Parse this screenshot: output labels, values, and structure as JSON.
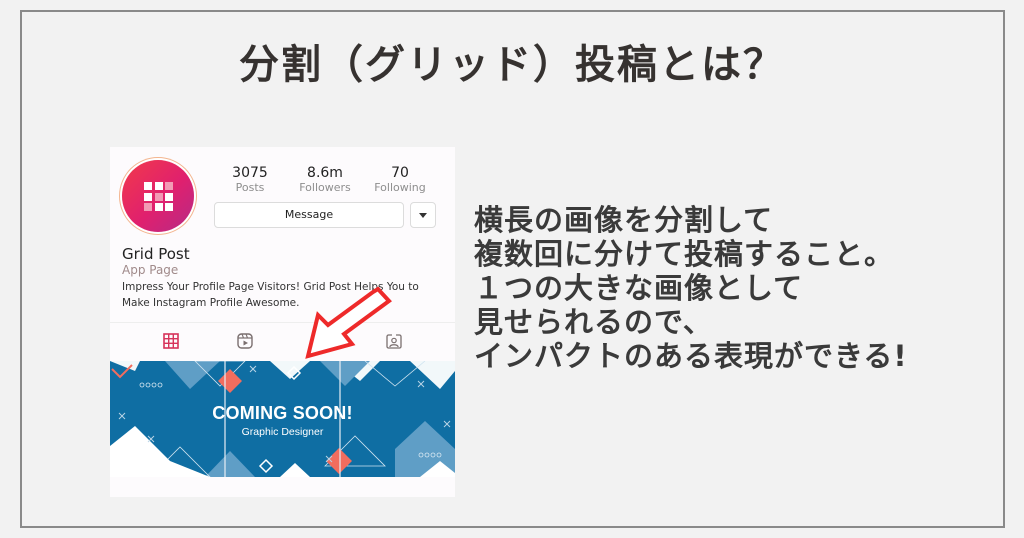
{
  "title": "分割（グリッド）投稿とは？",
  "description": {
    "lines": [
      "横長の画像を分割して",
      "複数回に分けて投稿すること。",
      "１つの大きな画像として",
      "見せられるので、",
      "インパクトのある表現ができる!"
    ]
  },
  "profile": {
    "avatar_icon": "grid-app-logo-icon",
    "stats": [
      {
        "value": "3075",
        "label": "Posts"
      },
      {
        "value": "8.6m",
        "label": "Followers"
      },
      {
        "value": "70",
        "label": "Following"
      }
    ],
    "message_button": "Message",
    "dropdown_icon": "caret-down-icon",
    "name": "Grid Post",
    "category": "App Page",
    "bio": "Impress Your Profile Page Visitors! Grid Post Helps You to Make Instagram Profile Awesome.",
    "tabs": [
      {
        "icon": "grid-icon",
        "active": true
      },
      {
        "icon": "reels-icon",
        "active": false
      },
      {
        "icon": "tagged-icon",
        "active": false
      }
    ]
  },
  "banner": {
    "title": "COMING SOON!",
    "subtitle": "Graphic Designer",
    "split_count": 3
  },
  "colors": {
    "accent_red": "#ee2a2a",
    "banner_blue": "#0f6ea3",
    "coral": "#f26d5e",
    "active_tab": "#d6335a"
  }
}
